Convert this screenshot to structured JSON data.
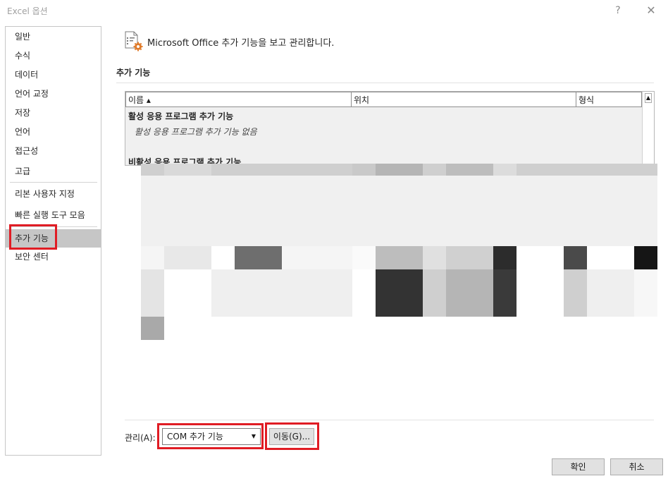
{
  "window": {
    "title": "Excel 옵션",
    "help_glyph": "?",
    "close_glyph": "✕"
  },
  "sidebar": {
    "items": [
      {
        "label": "일반"
      },
      {
        "label": "수식"
      },
      {
        "label": "데이터"
      },
      {
        "label": "언어 교정"
      },
      {
        "label": "저장"
      },
      {
        "label": "언어"
      },
      {
        "label": "접근성"
      },
      {
        "label": "고급"
      },
      {
        "label": "리본 사용자 지정"
      },
      {
        "label": "빠른 실행 도구 모음"
      },
      {
        "label": "추가 기능",
        "selected": true
      },
      {
        "label": "보안 센터"
      }
    ]
  },
  "main": {
    "header_text": "Microsoft Office 추가 기능을 보고 관리합니다.",
    "section_title": "추가 기능",
    "columns": [
      "이름 ▴",
      "위치",
      "형식"
    ],
    "groups": [
      {
        "label": "활성 응용 프로그램 추가 기능",
        "empty_text": "활성 응용 프로그램 추가 기능 없음"
      },
      {
        "label": "비활성 응용 프로그램 추가 기능"
      }
    ],
    "scroll_up_glyph": "▲"
  },
  "footer": {
    "manage_label": "관리(A):",
    "manage_value": "COM 추가 기능",
    "dropdown_glyph": "▼",
    "go_button": "이동(G)...",
    "ok_button": "확인",
    "cancel_button": "취소"
  },
  "colors": {
    "highlight": "#e01c24",
    "selected_bg": "#c6c6c6",
    "icon_accent": "#e07b2a"
  }
}
